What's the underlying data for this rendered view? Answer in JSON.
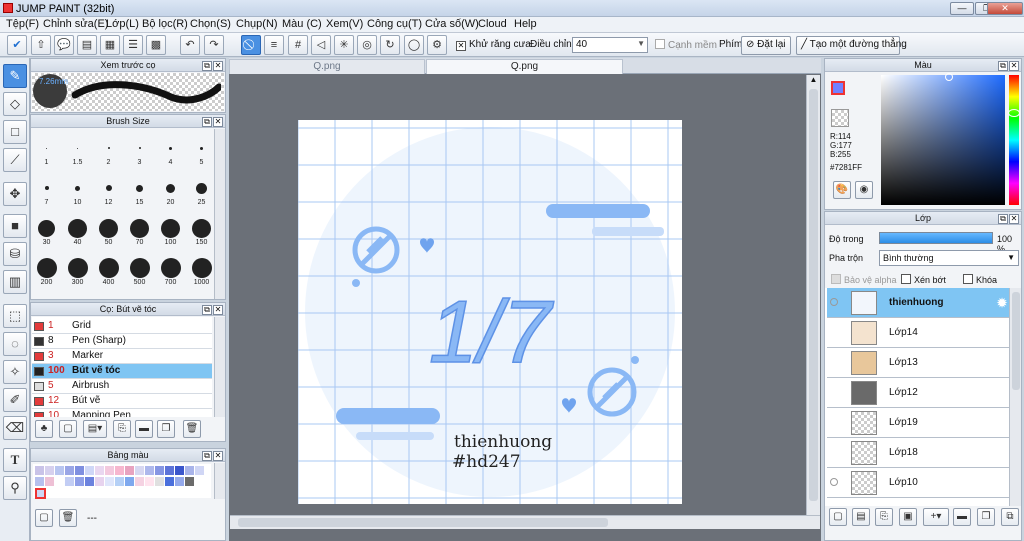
{
  "app": {
    "title": "JUMP PAINT (32bit)"
  },
  "window_buttons": {
    "minimize": "—",
    "restore": "❐",
    "close": "✕"
  },
  "menu": [
    "Tệp(F)",
    "Chỉnh sửa(E)",
    "Lớp(L)",
    "Bộ lọc(R)",
    "Chọn(S)",
    "Chụp(N)",
    "Màu (C)",
    "Xem(V)",
    "Công cụ(T)",
    "Cửa số(W)",
    "Cloud",
    "Help"
  ],
  "toolbar": {
    "antialias_label": "Khử răng cưa",
    "adjust_label": "Điều chỉnh",
    "adjust_value": "40",
    "snap_label": "Cạnh mềm",
    "key_label": "Phím",
    "reset_label": "Đặt lại",
    "straight_line_label": "Tạo một đường thẳng"
  },
  "brush_preview": {
    "title": "Xem trước cọ",
    "size": "7.26mm"
  },
  "brush_size": {
    "title": "Brush Size",
    "sizes": [
      "1",
      "1.5",
      "2",
      "3",
      "4",
      "5",
      "7",
      "10",
      "12",
      "15",
      "20",
      "25",
      "30",
      "40",
      "50",
      "70",
      "100",
      "150",
      "200",
      "300",
      "400",
      "500",
      "700",
      "1000"
    ]
  },
  "brush_list": {
    "title": "Cọ: Bút vẽ tóc",
    "items": [
      {
        "num": "1",
        "name": "Grid",
        "color": "#e33b3b"
      },
      {
        "num": "8",
        "name": "Pen (Sharp)",
        "color": "#333333"
      },
      {
        "num": "3",
        "name": "Marker",
        "color": "#e33b3b"
      },
      {
        "num": "100",
        "name": "Bút vẽ tóc",
        "color": "#222222"
      },
      {
        "num": "5",
        "name": "Airbrush",
        "color": "#dddddd"
      },
      {
        "num": "12",
        "name": "Bút vẽ",
        "color": "#e33b3b"
      },
      {
        "num": "10",
        "name": "Mapping Pen",
        "color": "#e33b3b"
      }
    ]
  },
  "palette": {
    "title": "Bảng màu",
    "status": "---"
  },
  "tabs": [
    "Q.png",
    "Q.png"
  ],
  "artwork": {
    "main": "1/7",
    "line1": "thienhuong",
    "line2": "#hd247"
  },
  "color_panel": {
    "title": "Màu",
    "r": "R:114",
    "g": "G:177",
    "b": "B:255",
    "hex": "#7281FF"
  },
  "layer_panel": {
    "title": "Lớp",
    "opacity_label": "Độ trong",
    "opacity_value": "100 %",
    "opacity": 1.0,
    "blend_label": "Pha trộn",
    "blend_value": "Bình thường",
    "protect_alpha": "Bảo vệ alpha",
    "clipping": "Xén bớt",
    "lock": "Khóa",
    "layers": [
      "thienhuong",
      "Lớp14",
      "Lớp13",
      "Lớp12",
      "Lớp19",
      "Lớp18",
      "Lớp10"
    ]
  },
  "colors": {
    "accent": "#4a90e2",
    "selection": "#7fc5f3",
    "art_blue": "#8ab8f5"
  }
}
